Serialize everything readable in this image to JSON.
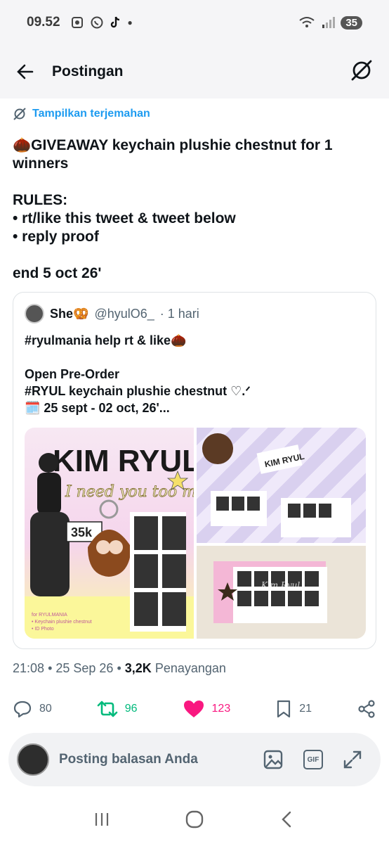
{
  "status_bar": {
    "time": "09.52",
    "battery": "35"
  },
  "app_bar": {
    "title": "Postingan"
  },
  "translate_label": "Tampilkan terjemahan",
  "tweet": {
    "text": "🌰GIVEAWAY keychain plushie chestnut for 1 winners\n\nRULES:\n• rt/like this tweet & tweet below\n• reply proof\n\nend 5 oct 26'"
  },
  "quote": {
    "name": "She🥨",
    "handle": "@hyulO6_",
    "time": "· 1 hari",
    "text": "#ryulmania help rt & like🌰\n\nOpen Pre-Order\n#RYUL keychain plushie chestnut ♡.ᐟ\n🗓️ 25 sept - 02 oct, 26'...",
    "media": {
      "poster_title": "KIM RYUL",
      "script_text": "I need you too much",
      "price_tag": "35k",
      "caption_lines": [
        "for RYULMANIA",
        "• Keychain plushie chestnut",
        "• ID Photo"
      ],
      "card_text": "KIM RYUL",
      "card_script": "Kim Ryul"
    }
  },
  "meta": {
    "time": "21:08",
    "date": "25 Sep 26",
    "views": "3,2K",
    "views_label": "Penayangan"
  },
  "actions": {
    "replies": "80",
    "reposts": "96",
    "likes": "123",
    "bookmarks": "21"
  },
  "reply_bar": {
    "placeholder": "Posting balasan Anda",
    "gif_label": "GIF"
  },
  "colors": {
    "accent": "#1d9bf0",
    "repost": "#00ba7c",
    "like": "#f91880"
  }
}
